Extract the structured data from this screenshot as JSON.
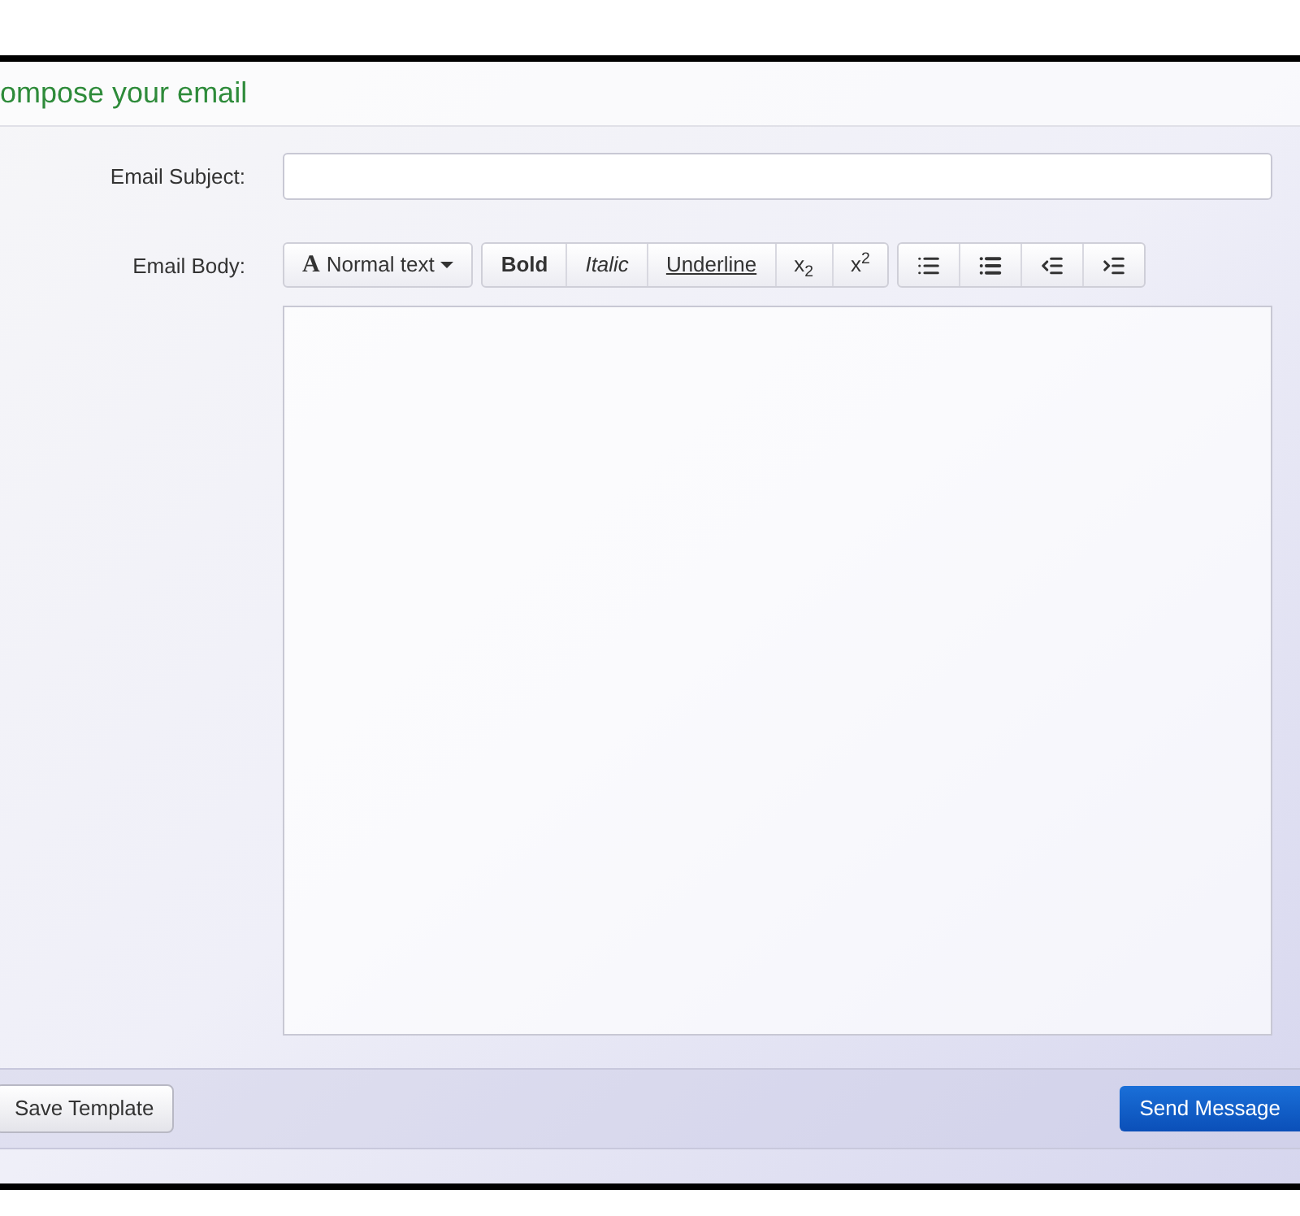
{
  "panel": {
    "title": "ompose your email"
  },
  "subject": {
    "label": "Email Subject:"
  },
  "body": {
    "label": "Email Body:"
  },
  "toolbar": [
    {
      "items": [
        {
          "kind": "dropdown",
          "icon": "A",
          "label": "Normal text"
        }
      ]
    },
    {
      "items": [
        {
          "kind": "bold",
          "label": "Bold"
        },
        {
          "kind": "italic",
          "label": "Italic"
        },
        {
          "kind": "underline",
          "label": "Underline"
        },
        {
          "kind": "text",
          "label": "x$_{2}$"
        },
        {
          "kind": "text",
          "label": "x$^{2}$"
        }
      ]
    },
    {
      "items": [
        {
          "kind": "list"
        },
        {
          "kind": "bullets"
        },
        {
          "kind": "outdent"
        },
        {
          "kind": "indent"
        }
      ]
    }
  ],
  "footer": {
    "buttons": [
      {
        "kind": "default",
        "label": "Save Template"
      },
      {
        "kind": "primary",
        "label": "Send Message"
      }
    ]
  }
}
